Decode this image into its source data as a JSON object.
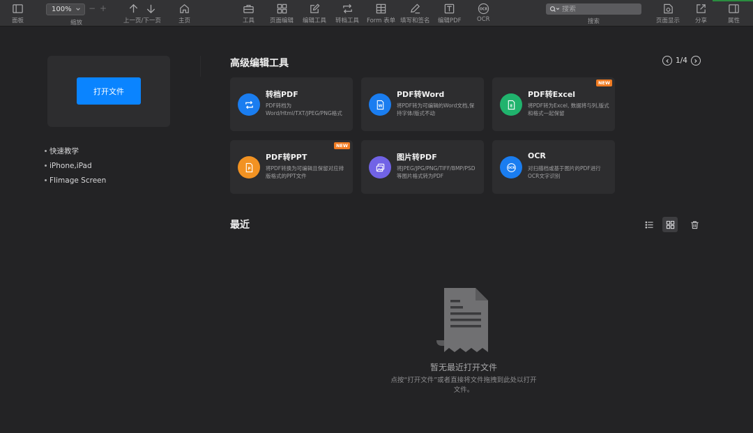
{
  "toolbar": {
    "panel_label": "面板",
    "zoom_value": "100%",
    "zoom_minus": "−",
    "zoom_plus": "+",
    "zoom_label": "缩放",
    "prev_next_label": "上一页/下一页",
    "home_label": "主页",
    "tools_label": "工具",
    "page_edit_label": "页面编辑",
    "edit_tools_label": "编辑工具",
    "convert_tools_label": "转档工具",
    "form_label": "Form 表单",
    "fill_sign_label": "填写和签名",
    "edit_pdf_label": "编辑PDF",
    "ocr_label": "OCR",
    "ocr_icon_text": "OCR",
    "search_placeholder": "搜索",
    "search_label": "搜索",
    "page_display_label": "页面显示",
    "share_label": "分享",
    "properties_label": "属性"
  },
  "left_panel": {
    "open_button": "打开文件",
    "links": [
      "快速教学",
      "iPhone,iPad",
      "FIimage Screen"
    ]
  },
  "tools_section": {
    "title": "高级编辑工具",
    "pager": "1/4",
    "cards": [
      {
        "title": "转档PDF",
        "desc": "PDF转档为Word/Html/TXT/JPEG/PNG格式",
        "badge": "",
        "icon": "convert-icon",
        "color": "#1a7df0"
      },
      {
        "title": "PDF转Word",
        "desc": "将PDF转为可编辑的Word文档,保持字体/版式不动",
        "badge": "",
        "icon": "word-icon",
        "color": "#1a7df0"
      },
      {
        "title": "PDF转Excel",
        "desc": "将PDF转为Excel, 数据将与列,版式和格式一起保留",
        "badge": "NEW",
        "icon": "excel-icon",
        "color": "#20b36d"
      },
      {
        "title": "PDF转PPT",
        "desc": "将PDF转换为可编辑且保留对应排版格式的PPT文件",
        "badge": "NEW",
        "icon": "ppt-icon",
        "color": "#f29222"
      },
      {
        "title": "图片转PDF",
        "desc": "将JPEG/JPG/PNG/TIFF/BMP/PSD等图片格式转为PDF",
        "badge": "",
        "icon": "image-icon",
        "color": "#7163e6"
      },
      {
        "title": "OCR",
        "desc": "对扫描档或基于图片的PDF进行OCR文字识别",
        "badge": "",
        "icon": "ocr-icon",
        "color": "#1a7df0"
      }
    ]
  },
  "recent_section": {
    "title": "最近",
    "empty_title": "暂无最近打开文件",
    "empty_desc": "点按“打开文件”或者直接将文件拖拽到此处以打开文件。"
  }
}
